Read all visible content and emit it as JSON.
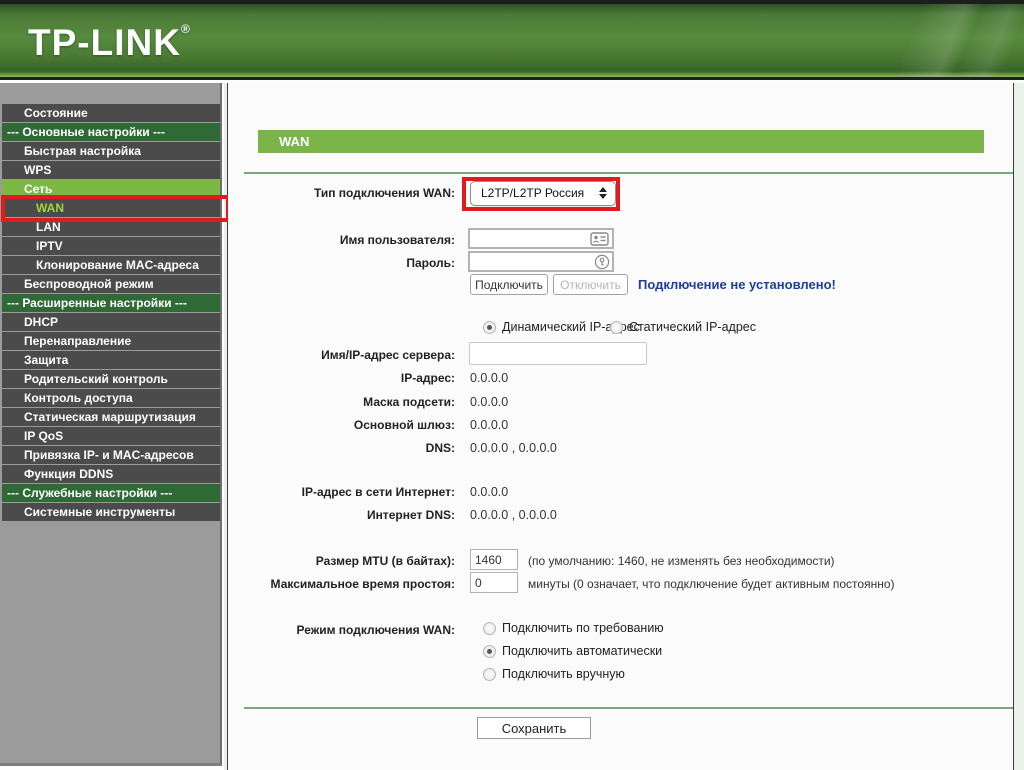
{
  "colors": {
    "accent_green": "#7bb54a",
    "section_green": "#2f6a36",
    "selected_green": "#7cb844",
    "highlight_red": "#e01b1b",
    "status_blue": "#1d3ca6",
    "active_text_green": "#9ed93a"
  },
  "header": {
    "logo": "TP-LINK",
    "registered": "®"
  },
  "sidebar": {
    "items": [
      {
        "label": "Состояние"
      },
      {
        "label": "--- Основные настройки ---"
      },
      {
        "label": "Быстрая настройка"
      },
      {
        "label": "WPS"
      },
      {
        "label": "Сеть"
      },
      {
        "label": "WAN"
      },
      {
        "label": "LAN"
      },
      {
        "label": "IPTV"
      },
      {
        "label": "Клонирование MAC-адреса"
      },
      {
        "label": "Беспроводной режим"
      },
      {
        "label": "--- Расширенные настройки ---"
      },
      {
        "label": "DHCP"
      },
      {
        "label": "Перенаправление"
      },
      {
        "label": "Защита"
      },
      {
        "label": "Родительский контроль"
      },
      {
        "label": "Контроль доступа"
      },
      {
        "label": "Статическая маршрутизация"
      },
      {
        "label": "IP QoS"
      },
      {
        "label": "Привязка IP- и MAC-адресов"
      },
      {
        "label": "Функция DDNS"
      },
      {
        "label": "--- Служебные настройки ---"
      },
      {
        "label": "Системные инструменты"
      }
    ]
  },
  "main": {
    "page_title": "WAN",
    "connection_type": {
      "label": "Тип подключения WAN:",
      "value": "L2TP/L2TP Россия"
    },
    "username": {
      "label": "Имя пользователя:",
      "value": ""
    },
    "password": {
      "label": "Пароль:",
      "value": ""
    },
    "connect_button": "Подключить",
    "disconnect_button": "Отключить",
    "status": "Подключение не установлено!",
    "ip_mode": {
      "options": [
        {
          "label": "Динамический IP-адрес"
        },
        {
          "label": "Статический IP-адрес"
        }
      ],
      "selected": "Динамический IP-адрес"
    },
    "server": {
      "label": "Имя/IP-адрес сервера:",
      "value": ""
    },
    "info_rows": [
      {
        "label": "IP-адрес:",
        "value": "0.0.0.0"
      },
      {
        "label": "Маска подсети:",
        "value": "0.0.0.0"
      },
      {
        "label": "Основной шлюз:",
        "value": "0.0.0.0"
      },
      {
        "label": "DNS:",
        "value": "0.0.0.0 , 0.0.0.0"
      }
    ],
    "internet_rows": [
      {
        "label": "IP-адрес в сети Интернет:",
        "value": "0.0.0.0"
      },
      {
        "label": "Интернет DNS:",
        "value": "0.0.0.0 , 0.0.0.0"
      }
    ],
    "mtu": {
      "label": "Размер MTU (в байтах):",
      "value": "1460",
      "note": "(по умолчанию: 1460, не изменять без необходимости)"
    },
    "idle": {
      "label": "Максимальное время простоя:",
      "value": "0",
      "note": "минуты (0 означает, что подключение будет активным постоянно)"
    },
    "wan_mode": {
      "label": "Режим подключения WAN:",
      "options": [
        {
          "label": "Подключить по требованию"
        },
        {
          "label": "Подключить автоматически"
        },
        {
          "label": "Подключить вручную"
        }
      ],
      "selected": "Подключить автоматически"
    },
    "save_button": "Сохранить"
  }
}
